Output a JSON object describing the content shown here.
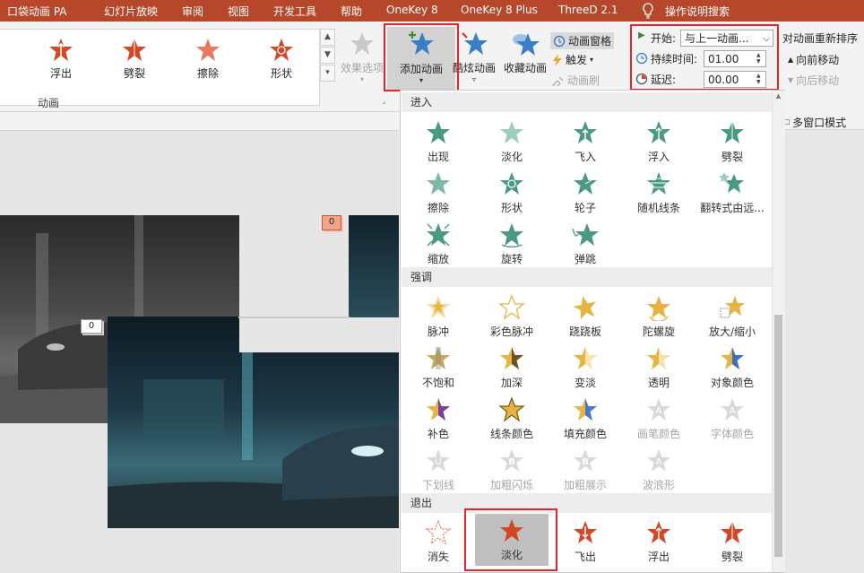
{
  "menubar": {
    "items": [
      "口袋动画 PA",
      "幻灯片放映",
      "审阅",
      "视图",
      "开发工具",
      "帮助",
      "OneKey 8",
      "OneKey 8 Plus",
      "ThreeD 2.1"
    ],
    "search": "操作说明搜索"
  },
  "ribbon": {
    "gallery": [
      "浮出",
      "劈裂",
      "擦除",
      "形状"
    ],
    "effect_options": "效果选项",
    "add_animation": "添加动画",
    "fancy_animation": "酷炫动画",
    "favorite_animation": "收藏动画",
    "animation_pane": "动画窗格",
    "trigger": "触发",
    "animation_painter": "动画刷",
    "group_animation": "动画",
    "start_label": "开始:",
    "start_value": "与上一动画...",
    "duration_label": "持续时间:",
    "duration_value": "01.00",
    "delay_label": "延迟:",
    "delay_value": "00.00",
    "reorder_title": "对动画重新排序",
    "move_earlier": "向前移动",
    "move_later": "向后移动"
  },
  "side": {
    "multiwindow": "多窗口模式"
  },
  "canvas": {
    "tag_a": "0",
    "tag_b": "0"
  },
  "dropdown": {
    "entrance_title": "进入",
    "entrance": [
      "出现",
      "淡化",
      "飞入",
      "浮入",
      "劈裂",
      "擦除",
      "形状",
      "轮子",
      "随机线条",
      "翻转式由远...",
      "缩放",
      "旋转",
      "弹跳"
    ],
    "emphasis_title": "强调",
    "emphasis": [
      "脉冲",
      "彩色脉冲",
      "跷跷板",
      "陀螺旋",
      "放大/缩小",
      "不饱和",
      "加深",
      "变淡",
      "透明",
      "对象颜色",
      "补色",
      "线条颜色",
      "填充颜色",
      "画笔颜色",
      "字体颜色",
      "下划线",
      "加粗闪烁",
      "加粗展示",
      "波浪形"
    ],
    "exit_title": "退出",
    "exit": [
      "消失",
      "淡化",
      "飞出",
      "浮出",
      "劈裂"
    ]
  },
  "colors": {
    "menubar": "#b7472a",
    "entrance_star": "#4a9a7e",
    "emphasis_star": "#e7b443",
    "exit_star": "#d24726",
    "ribbon_star_blue": "#3b7ec6",
    "highlight": "#e0262a"
  }
}
